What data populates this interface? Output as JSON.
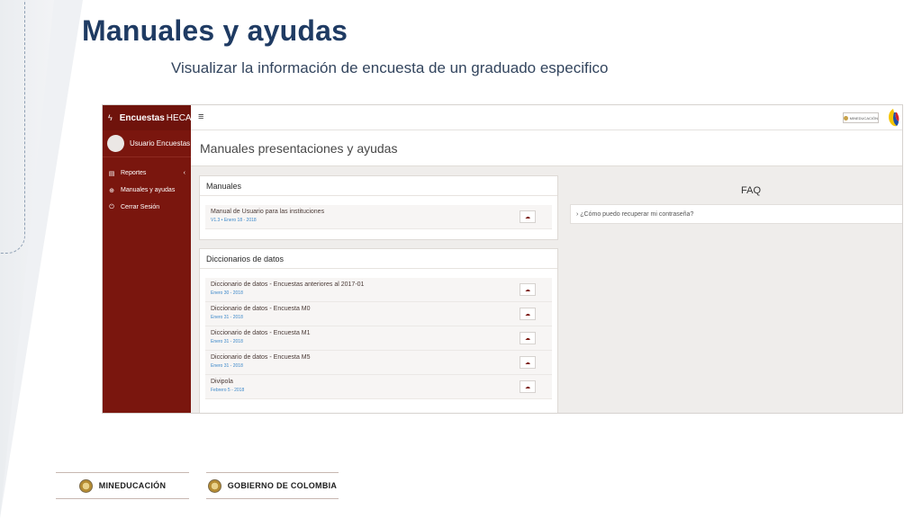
{
  "slide": {
    "title": "Manuales y ayudas",
    "subtitle": "Visualizar la información de encuesta de un graduado especifico"
  },
  "app": {
    "brand_bold": "Encuestas",
    "brand_rest": "HECAA",
    "user_name": "Usuario Encuestas",
    "nav": [
      {
        "label": "Reportes",
        "icon": "file-icon",
        "has_chevron": true
      },
      {
        "label": "Manuales y ayudas",
        "icon": "globe-icon",
        "has_chevron": false
      },
      {
        "label": "Cerrar Sesión",
        "icon": "power-icon",
        "has_chevron": false
      }
    ],
    "topbar_logo": "MINEDUCACIÓN",
    "page_title": "Manuales presentaciones y ayudas",
    "manuales": {
      "title": "Manuales",
      "items": [
        {
          "name": "Manual de Usuario para las instituciones",
          "date": "V1.3 • Enero 18 - 2018"
        }
      ]
    },
    "diccionarios": {
      "title": "Diccionarios de datos",
      "items": [
        {
          "name": "Diccionario de datos - Encuestas anteriores al 2017-01",
          "date": "Enero 30 - 2018"
        },
        {
          "name": "Diccionario de datos - Encuesta M0",
          "date": "Enero 31 - 2018"
        },
        {
          "name": "Diccionario de datos - Encuesta M1",
          "date": "Enero 31 - 2018"
        },
        {
          "name": "Diccionario de datos - Encuesta M5",
          "date": "Enero 31 - 2018"
        },
        {
          "name": "Divipola",
          "date": "Febrero 5 - 2018"
        }
      ]
    },
    "faq": {
      "title": "FAQ",
      "question": "› ¿Cómo puedo recuperar mi contraseña?"
    }
  },
  "footer": {
    "logo_left": "MINEDUCACIÓN",
    "logo_right": "GOBIERNO DE COLOMBIA"
  },
  "colors": {
    "sidebar": "#7a160e",
    "title": "#1f3b63",
    "link": "#3c88c9"
  }
}
